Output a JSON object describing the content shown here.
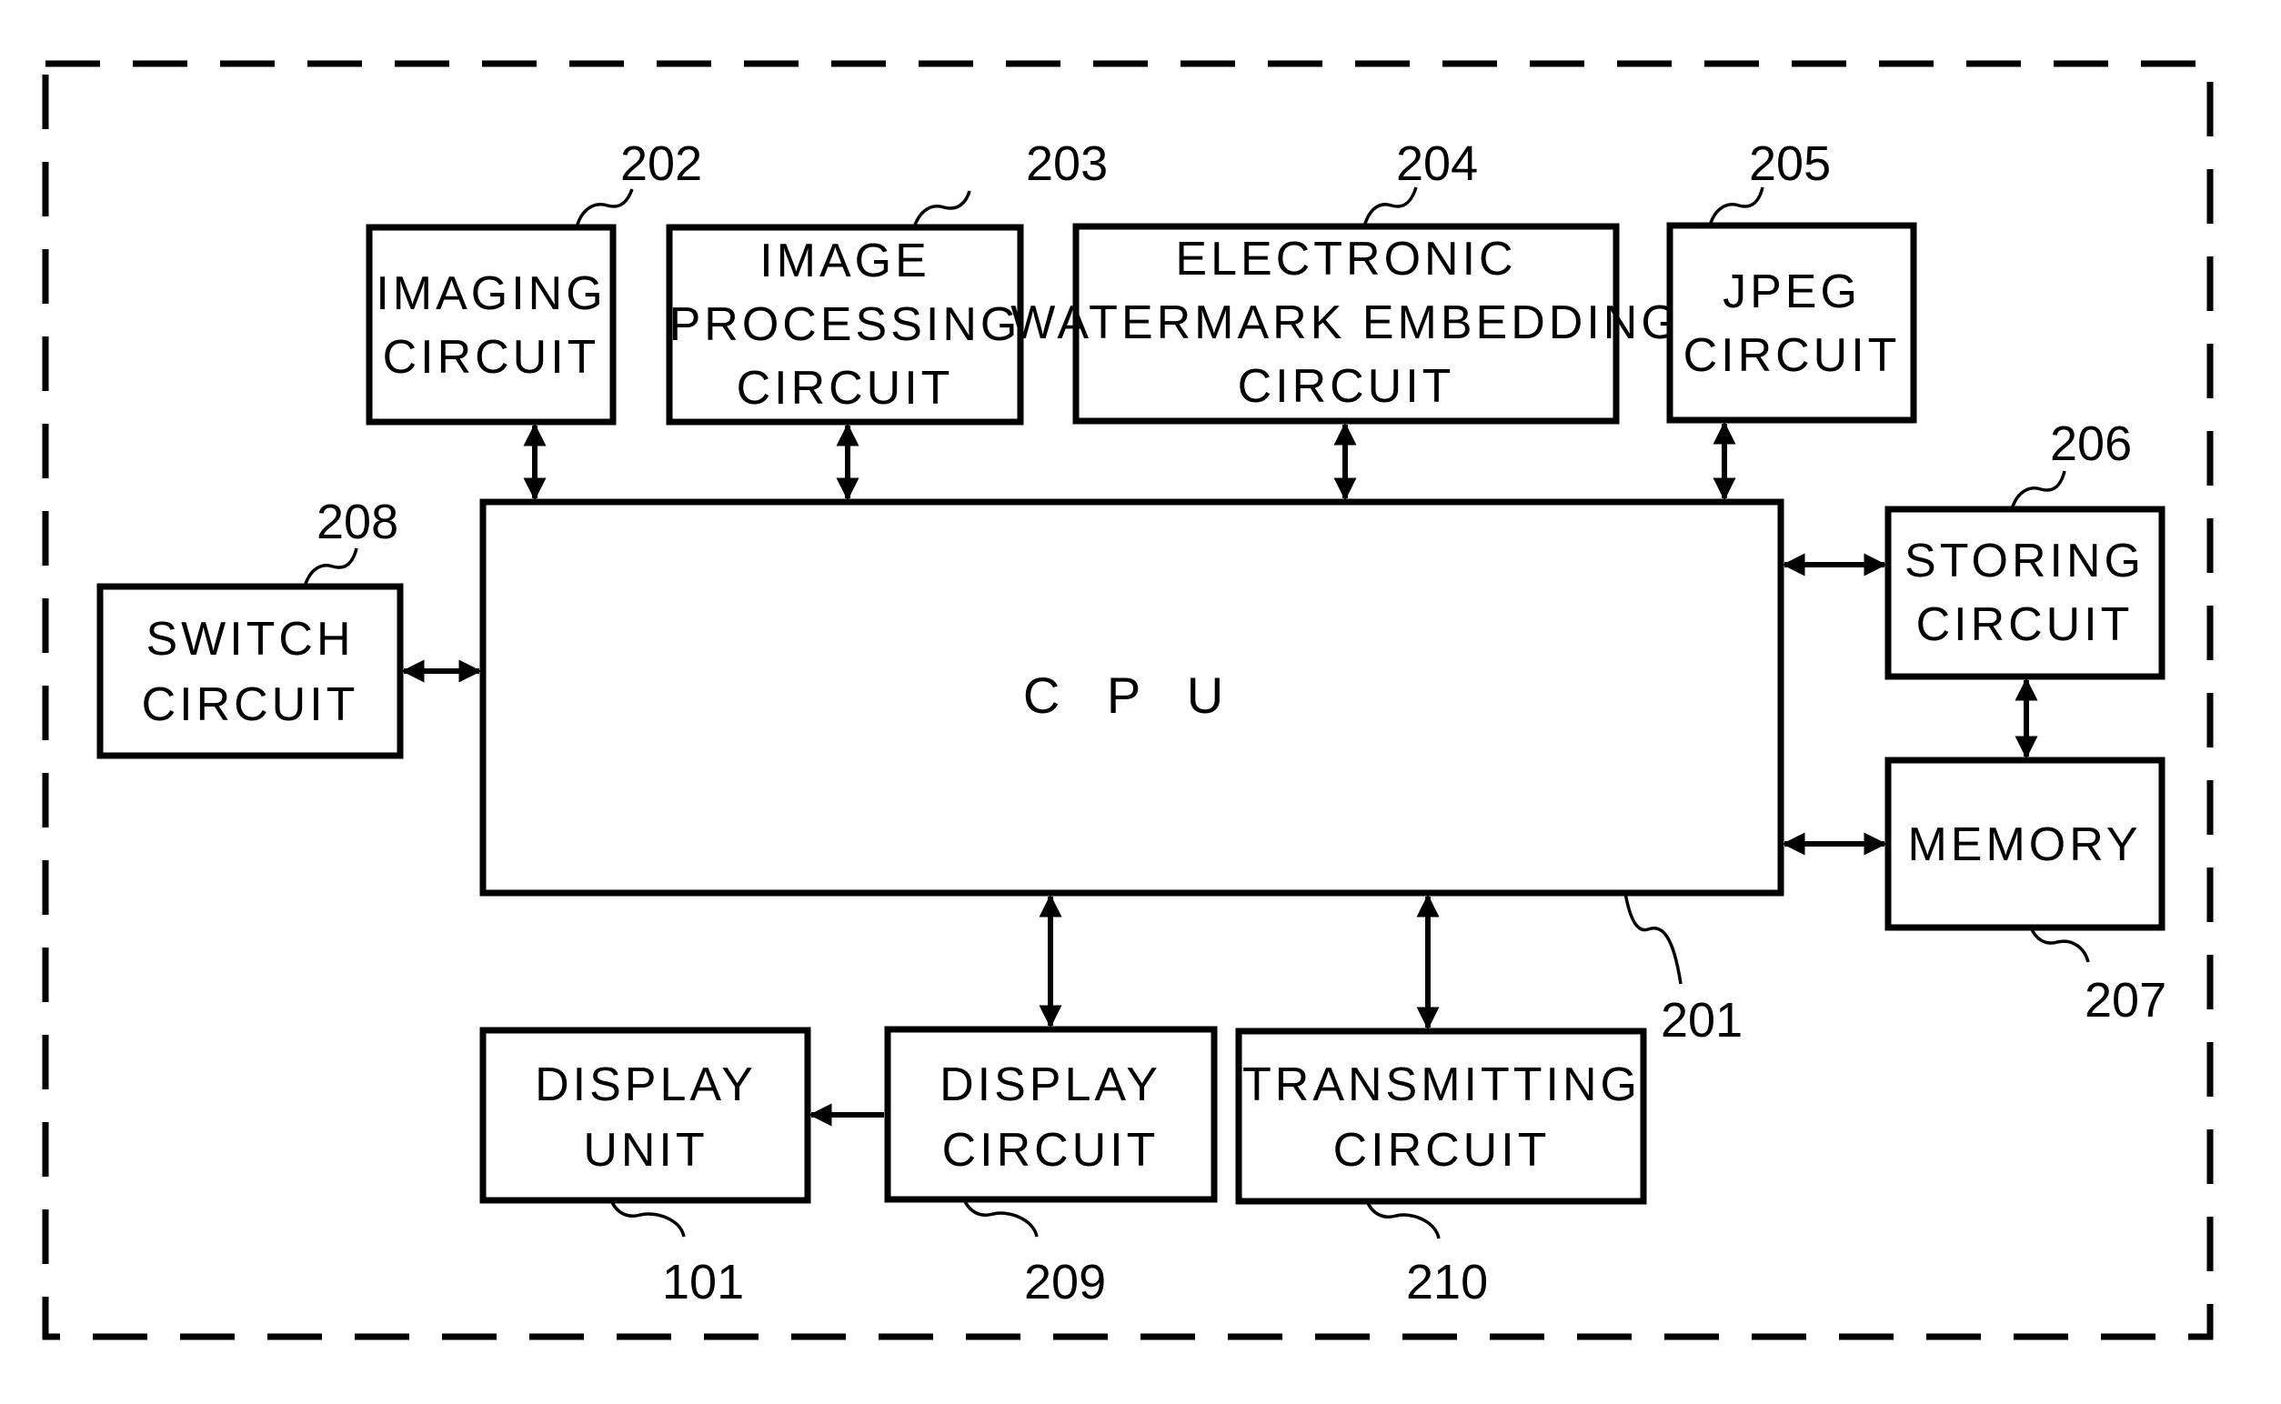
{
  "diagram": {
    "type": "block-diagram",
    "enclosure_style": "dashed",
    "blocks": {
      "cpu": {
        "ref": "201",
        "lines": [
          "C P U"
        ]
      },
      "imaging": {
        "ref": "202",
        "lines": [
          "IMAGING",
          "CIRCUIT"
        ]
      },
      "image_processing": {
        "ref": "203",
        "lines": [
          "IMAGE",
          "PROCESSING",
          "CIRCUIT"
        ]
      },
      "watermark": {
        "ref": "204",
        "lines": [
          "ELECTRONIC",
          "WATERMARK EMBEDDING",
          "CIRCUIT"
        ]
      },
      "jpeg": {
        "ref": "205",
        "lines": [
          "JPEG",
          "CIRCUIT"
        ]
      },
      "storing": {
        "ref": "206",
        "lines": [
          "STORING",
          "CIRCUIT"
        ]
      },
      "memory": {
        "ref": "207",
        "lines": [
          "MEMORY"
        ]
      },
      "switch": {
        "ref": "208",
        "lines": [
          "SWITCH",
          "CIRCUIT"
        ]
      },
      "display_circuit": {
        "ref": "209",
        "lines": [
          "DISPLAY",
          "CIRCUIT"
        ]
      },
      "transmitting": {
        "ref": "210",
        "lines": [
          "TRANSMITTING",
          "CIRCUIT"
        ]
      },
      "display_unit": {
        "ref": "101",
        "lines": [
          "DISPLAY",
          "UNIT"
        ]
      }
    },
    "connections": [
      {
        "from": "imaging",
        "to": "cpu",
        "direction": "bidirectional"
      },
      {
        "from": "image_processing",
        "to": "cpu",
        "direction": "bidirectional"
      },
      {
        "from": "watermark",
        "to": "cpu",
        "direction": "bidirectional"
      },
      {
        "from": "jpeg",
        "to": "cpu",
        "direction": "bidirectional"
      },
      {
        "from": "switch",
        "to": "cpu",
        "direction": "bidirectional"
      },
      {
        "from": "cpu",
        "to": "storing",
        "direction": "bidirectional"
      },
      {
        "from": "cpu",
        "to": "memory",
        "direction": "bidirectional"
      },
      {
        "from": "storing",
        "to": "memory",
        "direction": "bidirectional"
      },
      {
        "from": "cpu",
        "to": "display_circuit",
        "direction": "bidirectional"
      },
      {
        "from": "cpu",
        "to": "transmitting",
        "direction": "bidirectional"
      },
      {
        "from": "display_circuit",
        "to": "display_unit",
        "direction": "unidirectional"
      }
    ]
  }
}
